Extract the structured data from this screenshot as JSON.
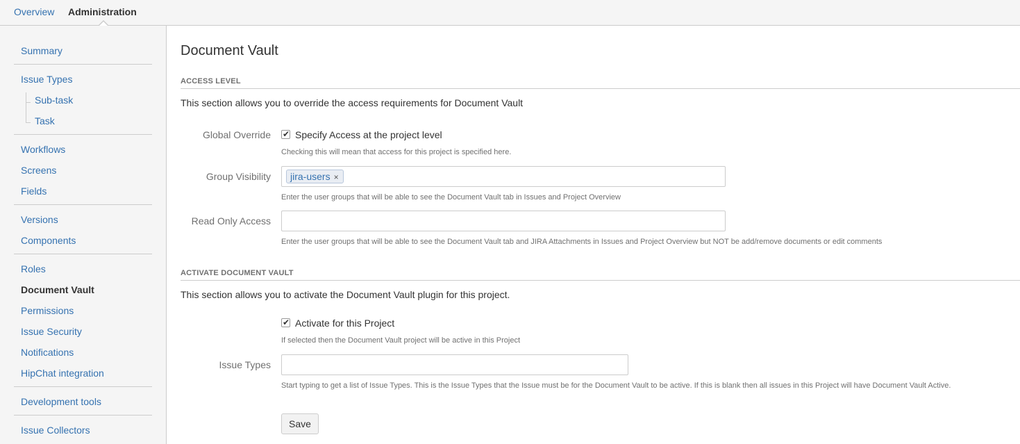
{
  "top_tabs": {
    "overview": "Overview",
    "administration": "Administration"
  },
  "sidebar": {
    "groups": [
      [
        "Summary"
      ],
      [
        "Issue Types",
        "Sub-task",
        "Task"
      ],
      [
        "Workflows",
        "Screens",
        "Fields"
      ],
      [
        "Versions",
        "Components"
      ],
      [
        "Roles",
        "Document Vault",
        "Permissions",
        "Issue Security",
        "Notifications",
        "HipChat integration"
      ],
      [
        "Development tools"
      ],
      [
        "Issue Collectors"
      ]
    ],
    "active_item": "Document Vault"
  },
  "main": {
    "title": "Document Vault",
    "access_section": {
      "heading": "ACCESS LEVEL",
      "description": "This section allows you to override the access requirements for Document Vault",
      "global_override": {
        "label": "Global Override",
        "checkbox_label": "Specify Access at the project level",
        "checked": true,
        "help": "Checking this will mean that access for this project is specified here."
      },
      "group_visibility": {
        "label": "Group Visibility",
        "tokens": [
          "jira-users"
        ],
        "token_remove": "×",
        "help": "Enter the user groups that will be able to see the Document Vault tab in Issues and Project Overview"
      },
      "read_only_access": {
        "label": "Read Only Access",
        "value": "",
        "help": "Enter the user groups that will be able to see the Document Vault tab and JIRA Attachments in Issues and Project Overview but NOT be add/remove documents or edit comments"
      }
    },
    "activate_section": {
      "heading": "ACTIVATE DOCUMENT VAULT",
      "description": "This section allows you to activate the Document Vault plugin for this project.",
      "activate": {
        "checkbox_label": "Activate for this Project",
        "checked": true,
        "help": "If selected then the Document Vault project will be active in this Project"
      },
      "issue_types": {
        "label": "Issue Types",
        "value": "",
        "help": "Start typing to get a list of Issue Types. This is the Issue Types that the Issue must be for the Document Vault to be active. If this is blank then all issues in this Project will have Document Vault Active."
      }
    },
    "save_label": "Save"
  },
  "colors": {
    "link": "#3572b0",
    "text": "#333333",
    "muted": "#707070",
    "border": "#cccccc",
    "sidebar_bg": "#f5f5f5"
  }
}
